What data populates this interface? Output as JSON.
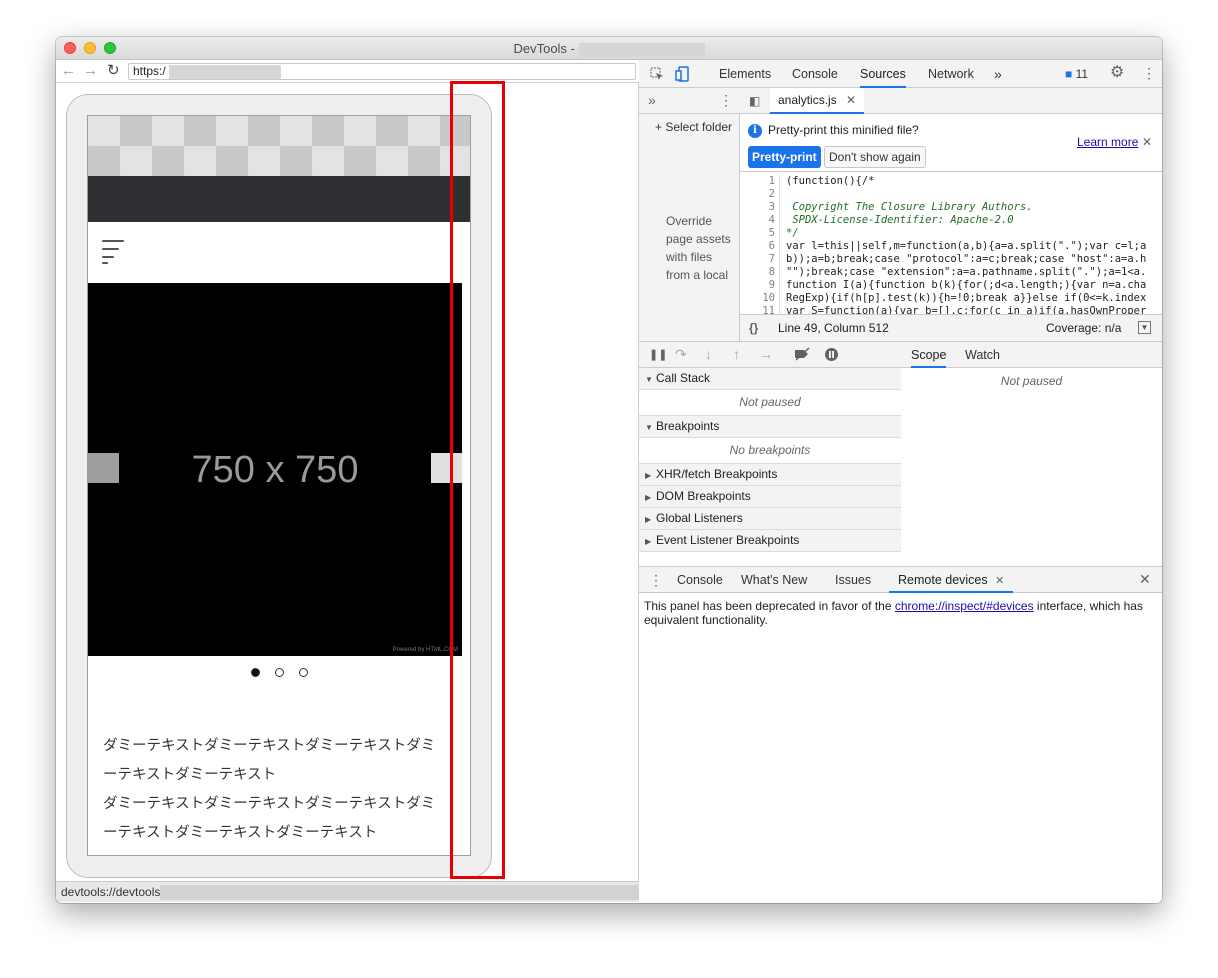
{
  "window": {
    "title": "DevTools -"
  },
  "browser": {
    "url": "https:/"
  },
  "page": {
    "slide_text": "750 x 750",
    "powered": "Powered by HTML.COM",
    "body_line1": "ダミーテキストダミーテキストダミーテキストダミーテキストダミーテキスト",
    "body_line2": "ダミーテキストダミーテキストダミーテキストダミーテキストダミーテキストダミーテキスト",
    "slide_count": 3,
    "active_slide": 1
  },
  "statusbar": {
    "text": "devtools://devtools"
  },
  "devtools": {
    "tabs": [
      "Elements",
      "Console",
      "Sources",
      "Network"
    ],
    "active_tab": "Sources",
    "more": "»",
    "issues_count": "11",
    "navigator": {
      "more": "»",
      "select_folder": "+ Select folder",
      "override_text": "Override page assets with files from a local"
    },
    "editor": {
      "file_tab": "analytics.js",
      "pretty_print_question": "Pretty-print this minified file?",
      "pretty_print_button": "Pretty-print",
      "dont_show_button": "Don't show again",
      "learn_more": "Learn more",
      "line_numbers": [
        "1",
        "2",
        "3",
        "4",
        "5",
        "6",
        "7",
        "8",
        "9",
        "10",
        "11"
      ],
      "code_lines": [
        "(function(){/*",
        "",
        " Copyright The Closure Library Authors.",
        " SPDX-License-Identifier: Apache-2.0",
        "*/",
        "var l=this||self,m=function(a,b){a=a.split(\".\");var c=l;a",
        "b));a=b;break;case \"protocol\":a=c;break;case \"host\":a=a.h",
        "\"\");break;case \"extension\":a=a.pathname.split(\".\");a=1<a.",
        "function I(a){function b(k){for(;d<a.length;){var n=a.cha",
        "RegExp){if(h[p].test(k)){h=!0;break a}}else if(0<=k.index",
        "var S=function(a){var b=[],c;for(c in a)if(a.hasOwnProper"
      ],
      "format_icon": "{}",
      "cursor": "Line 49, Column 512",
      "coverage": "Coverage: n/a"
    },
    "debugger": {
      "call_stack": "Call Stack",
      "call_stack_empty": "Not paused",
      "breakpoints": "Breakpoints",
      "breakpoints_empty": "No breakpoints",
      "xhr": "XHR/fetch Breakpoints",
      "dom": "DOM Breakpoints",
      "global": "Global Listeners",
      "event": "Event Listener Breakpoints"
    },
    "scope": {
      "tabs": [
        "Scope",
        "Watch"
      ],
      "empty": "Not paused"
    },
    "drawer": {
      "tabs": [
        "Console",
        "What's New",
        "Issues",
        "Remote devices"
      ],
      "active": "Remote devices",
      "message_before": "This panel has been deprecated in favor of the ",
      "link": "chrome://inspect/#devices",
      "message_after": " interface, which has equivalent functionality."
    }
  },
  "colors": {
    "accent": "#1a73e8",
    "highlight": "#e80000"
  }
}
